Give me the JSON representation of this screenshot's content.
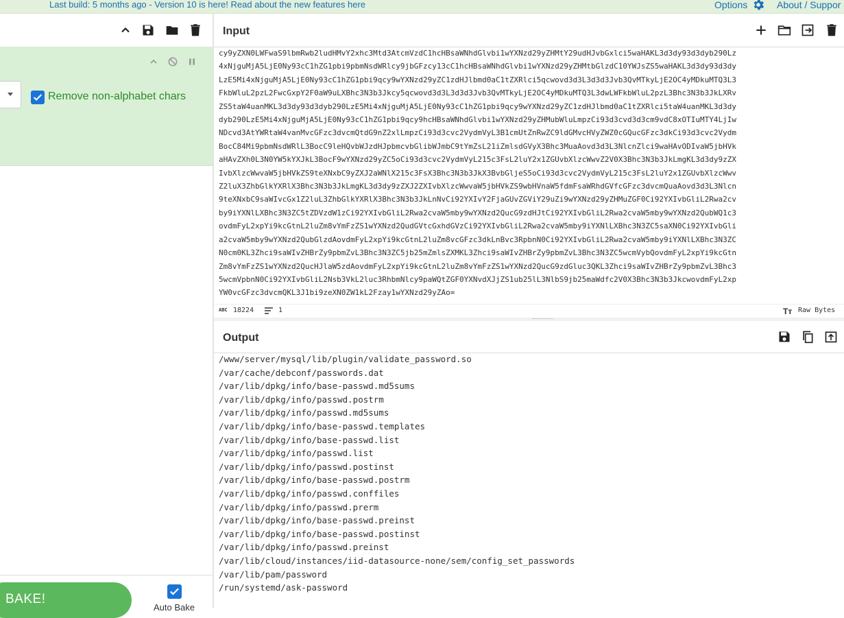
{
  "banner": {
    "message": "Last build: 5 months ago - Version 10 is here! Read about the new features here",
    "options_label": "Options",
    "about_label": "About / Suppor"
  },
  "recipe": {
    "operation": {
      "checkbox_label": "Remove non-alphabet chars",
      "checkbox_checked": true
    },
    "bake_label": "BAKE!",
    "autobake_label": "Auto Bake",
    "autobake_checked": true
  },
  "input": {
    "title": "Input",
    "lines": [
      "cy9yZXN0LWFwaS9lbmRwb2ludHMvY2xhc3Mtd3AtcmVzdC1hcHBsaWNhdGlvbi1wYXNzd29yZHMtY29udHJvbGxlci5waHAKL3d3dy93d3dyb290Lz",
      "4xNjguMjA5LjE0Ny93cC1hZG1pbi9pbmNsdWRlcy9jbGFzcy13cC1hcHBsaWNhdGlvbi1wYXNzd29yZHMtbGlzdC10YWJsZS5waHAKL3d3dy93d3dy",
      "LzE5Mi4xNjguMjA5LjE0Ny93cC1hZG1pbi9qcy9wYXNzd29yZC1zdHJlbmd0aC1tZXRlci5qcwovd3d3L3d3d3Jvb3QvMTkyLjE2OC4yMDkuMTQ3L3",
      "FkbWluL2pzL2FwcGxpY2F0aW9uLXBhc3N3b3Jkcy5qcwovd3d3L3d3d3Jvb3QvMTkyLjE2OC4yMDkuMTQ3L3dwLWFkbWluL2pzL3Bhc3N3b3JkLXRv",
      "ZS5taW4uanMKL3d3dy93d3dyb290LzE5Mi4xNjguMjA5LjE0Ny93cC1hZG1pbi9qcy9wYXNzd29yZC1zdHJlbmd0aC1tZXRlci5taW4uanMKL3d3dy",
      "dyb290LzE5Mi4xNjguMjA5LjE0Ny93cC1hZG1pbi9qcy9hcHBsaWNhdGlvbi1wYXNzd29yZHMubWluLmpzCi93d3cvd3d3cm9vdC8xOTIuMTY4LjIw",
      "NDcvd3AtYWRtaW4vanMvcGFzc3dvcmQtdG9nZ2xlLmpzCi93d3cvc2VydmVyL3B1cmUtZnRwZC9ldGMvcHVyZWZ0cGQucGFzc3dkCi93d3cvc2Vydm",
      "BocC84Mi9pbmNsdWRlL3BocC9leHQvbWJzdHJpbmcvbGlibWJmbC9tYmZsL21iZmlsdGVyX3Bhc3MuaAovd3d3L3NlcnZlci9waHAvODIvaW5jbHVk",
      "aHAvZXh0L3N0YW5kYXJkL3BocF9wYXNzd29yZC5oCi93d3cvc2VydmVyL215c3FsL2luY2x1ZGUvbXlzcWwvZ2V0X3Bhc3N3b3JkLmgKL3d3dy9zZX",
      "IvbXlzcWwvaW5jbHVkZS9teXNxbC9yZXJ2aWNlX215c3FsX3Bhc3N3b3JkX3BvbGljeS5oCi93d3cvc2VydmVyL215c3FsL2luY2x1ZGUvbXlzcWwv",
      "Z2luX3ZhbGlkYXRlX3Bhc3N3b3JkLmgKL3d3dy9zZXJ2ZXIvbXlzcWwvaW5jbHVkZS9wbHVnaW5fdmFsaWRhdGVfcGFzc3dvcmQuaAovd3d3L3Nlcn",
      "9teXNxbC9saWIvcGx1Z2luL3ZhbGlkYXRlX3Bhc3N3b3JkLnNvCi92YXIvY2FjaGUvZGViY29uZi9wYXNzd29yZHMuZGF0Ci92YXIvbGliL2Rwa2cv",
      "by9iYXNlLXBhc3N3ZC5tZDVzdW1zCi92YXIvbGliL2Rwa2cvaW5mby9wYXNzd2QucG9zdHJtCi92YXIvbGliL2Rwa2cvaW5mby9wYXNzd2QubWQ1c3",
      "ovdmFyL2xpYi9kcGtnL2luZm8vYmFzZS1wYXNzd2QudGVtcGxhdGVzCi92YXIvbGliL2Rwa2cvaW5mby9iYXNlLXBhc3N3ZC5saXN0Ci92YXIvbGli",
      "a2cvaW5mby9wYXNzd2QubGlzdAovdmFyL2xpYi9kcGtnL2luZm8vcGFzc3dkLnBvc3RpbnN0Ci92YXIvbGliL2Rwa2cvaW5mby9iYXNlLXBhc3N3ZC",
      "N0cm0KL3Zhci9saWIvZHBrZy9pbmZvL3Bhc3N3ZC5jb25mZmlsZXMKL3Zhci9saWIvZHBrZy9pbmZvL3Bhc3N3ZC5wcmVybQovdmFyL2xpYi9kcGtn",
      "Zm8vYmFzZS1wYXNzd2QucHJlaW5zdAovdmFyL2xpYi9kcGtnL2luZm8vYmFzZS1wYXNzd2QucG9zdGluc3QKL3Zhci9saWIvZHBrZy9pbmZvL3Bhc3",
      "5wcmVpbnN0Ci92YXIvbGliL2Nsb3VkL2luc3RhbmNlcy9paWQtZGF0YXNvdXJjZS1ub25lL3NlbS9jb25maWdfc2V0X3Bhc3N3b3JkcwovdmFyL2xp",
      "YW0vcGFzc3dvcmQKL3J1bi9zeXN0ZW1kL2Fzay1wYXNzd29yZAo="
    ],
    "status": {
      "length": "18224",
      "lines": "1",
      "encoding": "Raw Bytes"
    }
  },
  "output": {
    "title": "Output",
    "lines": [
      "/www/server/mysql/lib/plugin/validate_password.so",
      "/var/cache/debconf/passwords.dat",
      "/var/lib/dpkg/info/base-passwd.md5sums",
      "/var/lib/dpkg/info/passwd.postrm",
      "/var/lib/dpkg/info/passwd.md5sums",
      "/var/lib/dpkg/info/base-passwd.templates",
      "/var/lib/dpkg/info/base-passwd.list",
      "/var/lib/dpkg/info/passwd.list",
      "/var/lib/dpkg/info/passwd.postinst",
      "/var/lib/dpkg/info/base-passwd.postrm",
      "/var/lib/dpkg/info/passwd.conffiles",
      "/var/lib/dpkg/info/passwd.prerm",
      "/var/lib/dpkg/info/base-passwd.preinst",
      "/var/lib/dpkg/info/base-passwd.postinst",
      "/var/lib/dpkg/info/passwd.preinst",
      "/var/lib/cloud/instances/iid-datasource-none/sem/config_set_passwords",
      "/var/lib/pam/password",
      "/run/systemd/ask-password"
    ]
  },
  "colors": {
    "accent": "#1a74d6",
    "bake": "#5cb85c",
    "banner_bg": "#e2f0dc",
    "operation_bg": "#daf0d6"
  }
}
